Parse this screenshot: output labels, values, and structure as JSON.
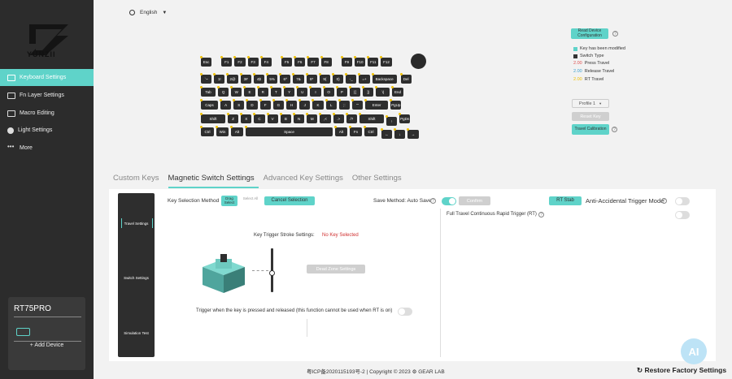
{
  "sidebar": {
    "brand": "YUNZII",
    "items": [
      {
        "label": "Keyboard Settings",
        "icon": "keyboard-icon"
      },
      {
        "label": "Fn Layer Settings",
        "icon": "fn-icon"
      },
      {
        "label": "Macro Editing",
        "icon": "macro-icon"
      },
      {
        "label": "Light Settings",
        "icon": "light-icon"
      },
      {
        "label": "More",
        "icon": "more-icon"
      }
    ],
    "device_name": "RT75PRO",
    "add_device": "+ Add Device"
  },
  "header": {
    "language": "English"
  },
  "keyboard": {
    "rows": [
      [
        "Esc",
        "F1",
        "F2",
        "F3",
        "F4",
        "F5",
        "F6",
        "F7",
        "F8",
        "F9",
        "F10",
        "F11",
        "F12"
      ],
      [
        "`~",
        "1!",
        "2@",
        "3#",
        "4$",
        "5%",
        "6^",
        "7&",
        "8*",
        "9(",
        "0)",
        "-_",
        "=+",
        "Backspace",
        "Del"
      ],
      [
        "Tab",
        "Q",
        "W",
        "E",
        "R",
        "T",
        "Y",
        "U",
        "I",
        "O",
        "P",
        "[{",
        "]}",
        "\\|",
        "End"
      ],
      [
        "Caps",
        "A",
        "S",
        "D",
        "F",
        "G",
        "H",
        "J",
        "K",
        "L",
        ";:",
        "'\"",
        "Enter",
        "PgUp"
      ],
      [
        "Shift",
        "Z",
        "X",
        "C",
        "V",
        "B",
        "N",
        "M",
        ",<",
        ".>",
        "/?",
        "Shift",
        "↑",
        "PgDn"
      ],
      [
        "Ctrl",
        "Win",
        "Alt",
        "Space",
        "Alt",
        "Fn",
        "Ctrl",
        "←",
        "↓",
        "→"
      ]
    ]
  },
  "right_panel": {
    "read_device": "Read Device Configuration",
    "legend": [
      {
        "label": "Key has been modified",
        "color": "#5fd3c9"
      },
      {
        "label": "Switch Type",
        "color": "#333333"
      },
      {
        "value": "2.00",
        "label": "Press Travel",
        "color": "#e05050"
      },
      {
        "value": "2.00",
        "label": "Release Travel",
        "color": "#3aa0d0"
      },
      {
        "value": "2.00",
        "label": "RT Travel",
        "color": "#f0c000"
      }
    ],
    "profile": "Profile 1",
    "reset_key": "Reset Key",
    "travel_calibration": "Travel Calibration"
  },
  "tabs": [
    "Custom Keys",
    "Magnetic Switch Settings",
    "Advanced Key Settings",
    "Other Settings"
  ],
  "vertical_tabs": [
    "Travel Settings",
    "Switch Settings",
    "Simulation Test"
  ],
  "panel": {
    "key_selection_method": "Key Selection Method",
    "drag_select": "Drag Select",
    "select_all": "Select All",
    "cancel_selection": "Cancel Selection",
    "save_method": "Save Method: Auto Save",
    "confirm": "Confirm",
    "rt_stab": "RT Stab",
    "anti_accidental": "Anti-Accidental Trigger Mode",
    "full_travel": "Full Travel Continuous Rapid Trigger (RT)",
    "stroke_settings": "Key Trigger Stroke Settings:",
    "no_key": "No Key Selected",
    "dead_zone": "Dead Zone Settings",
    "trigger_release": "Trigger when the key is pressed and released (this function cannot be used when RT is on)"
  },
  "footer": {
    "copyright": "粤ICP备2020115193号-2 | Copyright © 2023 ⚙ GEAR LAB",
    "restore": "Restore Factory Settings"
  },
  "colors": {
    "accent": "#5fd3c9",
    "sidebar": "#2c2c2c",
    "key": "#2e2e2e"
  }
}
